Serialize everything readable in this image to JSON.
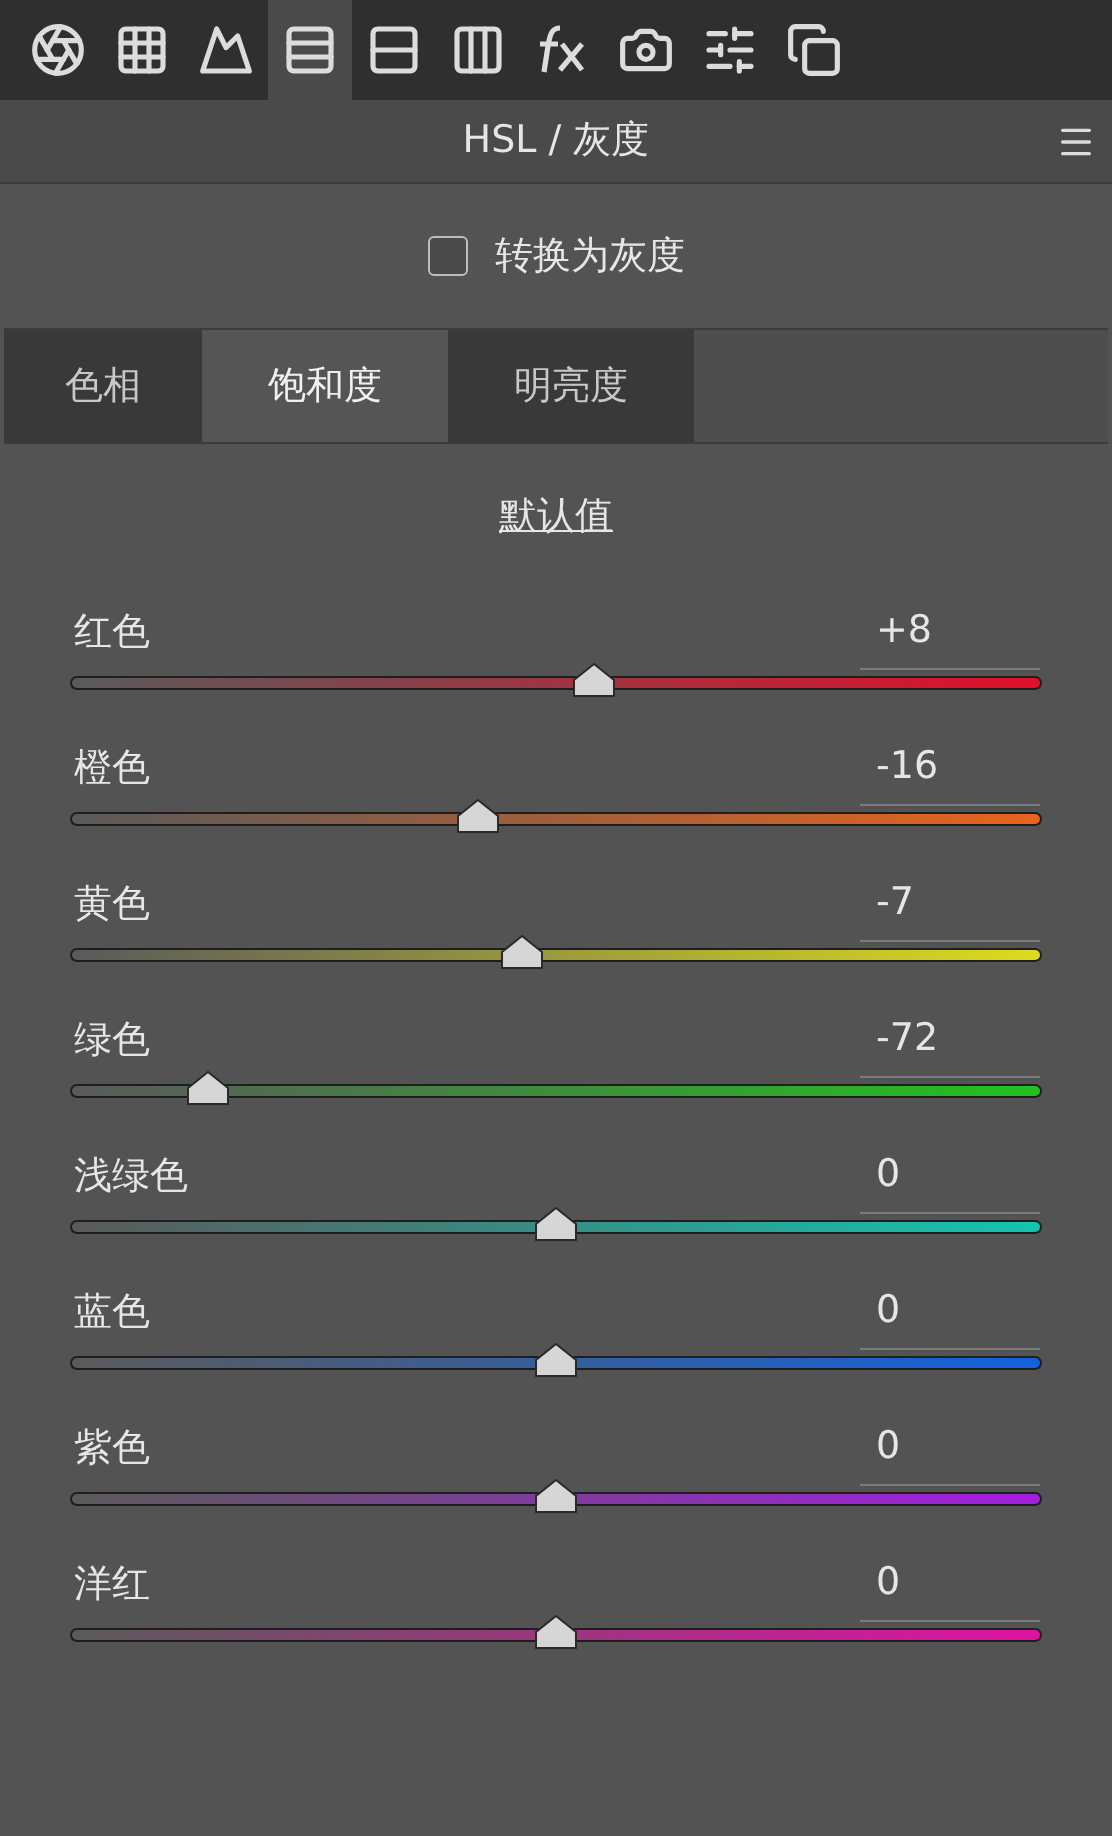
{
  "toolbar": [
    {
      "selected": false
    },
    {
      "selected": false
    },
    {
      "selected": false
    },
    {
      "selected": true
    },
    {
      "selected": false
    },
    {
      "selected": false
    },
    {
      "selected": false
    },
    {
      "selected": false
    },
    {
      "selected": false
    },
    {
      "selected": false
    }
  ],
  "panel": {
    "title": "HSL / 灰度"
  },
  "grayscale": {
    "label": "转换为灰度",
    "checked": false
  },
  "tabs": [
    {
      "label": "色相",
      "selected": false
    },
    {
      "label": "饱和度",
      "selected": true
    },
    {
      "label": "明亮度",
      "selected": false
    }
  ],
  "default_link": "默认值",
  "sliders": [
    {
      "name": "红色",
      "value": "+8",
      "level": 0.54,
      "color": "#e0102a"
    },
    {
      "name": "橙色",
      "value": "-16",
      "level": 0.42,
      "color": "#e8641c"
    },
    {
      "name": "黄色",
      "value": "-7",
      "level": 0.465,
      "color": "#dcdc1e"
    },
    {
      "name": "绿色",
      "value": "-72",
      "level": 0.14,
      "color": "#22c21e"
    },
    {
      "name": "浅绿色",
      "value": "0",
      "level": 0.5,
      "color": "#14c4b0"
    },
    {
      "name": "蓝色",
      "value": "0",
      "level": 0.5,
      "color": "#1262de"
    },
    {
      "name": "紫色",
      "value": "0",
      "level": 0.5,
      "color": "#a41ee0"
    },
    {
      "name": "洋红",
      "value": "0",
      "level": 0.5,
      "color": "#e012a4"
    }
  ]
}
